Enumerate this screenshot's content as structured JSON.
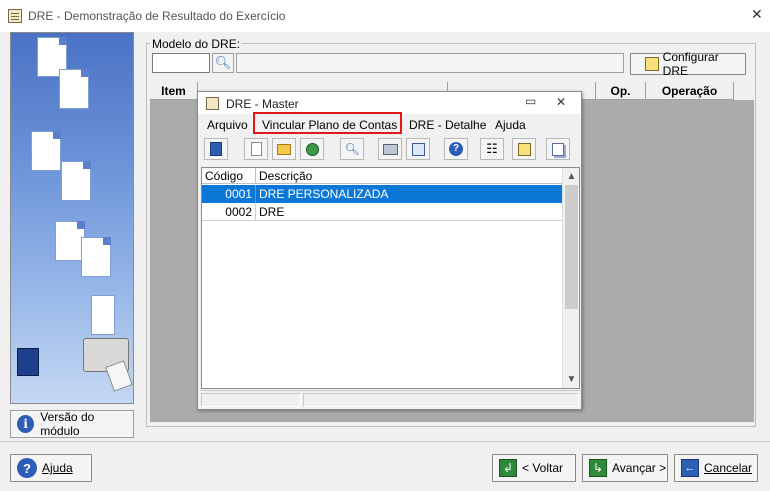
{
  "window": {
    "title": "DRE - Demonstração de Resultado do Exercício",
    "close_glyph": "✕"
  },
  "model": {
    "legend": "Modelo do DRE:",
    "code_value": "",
    "description_value": "",
    "search_icon": "magnifier-icon",
    "config_button": "Configurar DRE"
  },
  "grid": {
    "columns": [
      "Item",
      "",
      "",
      "Op.",
      "Operação"
    ]
  },
  "sidebar": {
    "version_button": "Versão do módulo"
  },
  "child": {
    "title": "DRE - Master",
    "min_glyph": "▭",
    "close_glyph": "✕",
    "menu": [
      "Arquivo",
      "Vincular Plano de Contas",
      "DRE - Detalhe",
      "Ajuda"
    ],
    "toolbar_icons": [
      "exit-icon",
      "new-icon",
      "open-folder-icon",
      "refresh-icon",
      "search-icon",
      "print-icon",
      "preview-icon",
      "help-icon",
      "tree-icon",
      "edit-icon",
      "copy-icon"
    ],
    "list": {
      "columns": [
        "Código",
        "Descrição"
      ],
      "rows": [
        {
          "code": "0001",
          "description": "DRE PERSONALIZADA",
          "selected": true
        },
        {
          "code": "0002",
          "description": "DRE",
          "selected": false
        }
      ]
    }
  },
  "footer": {
    "help": "Ajuda",
    "back": "< Voltar",
    "next": "Avançar >",
    "cancel": "Cancelar"
  },
  "colors": {
    "selection": "#0b78d7",
    "highlight_border": "#e01818"
  }
}
